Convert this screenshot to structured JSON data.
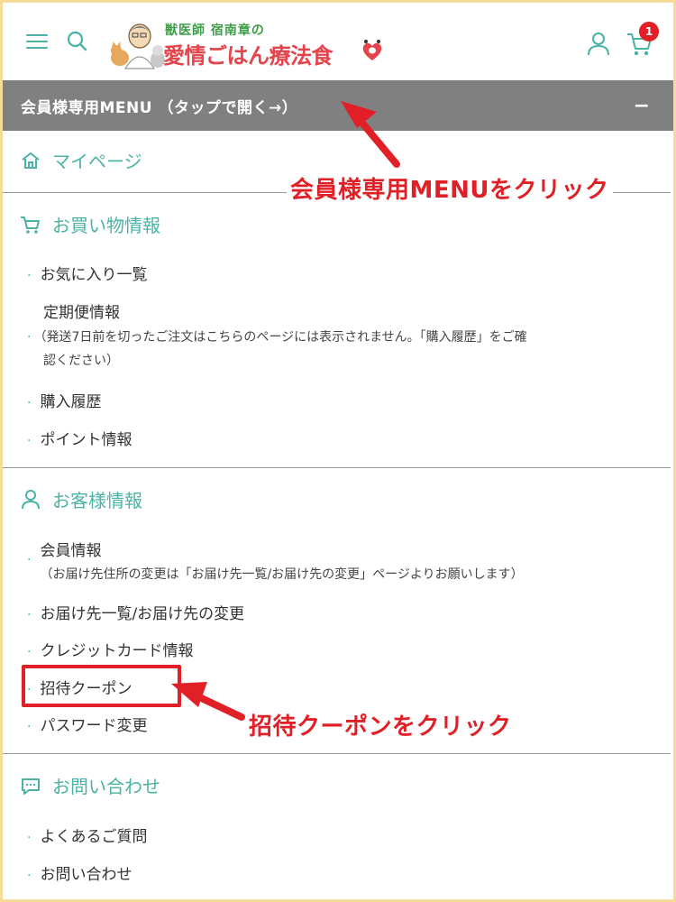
{
  "header": {
    "logo_sub": "獣医師 宿南章の",
    "logo_main": "愛情ごはん療法食",
    "cart_count": "1",
    "accent_color": "#4ab3a6"
  },
  "member_menu": {
    "label": "会員様専用MENU （タップで開く→）",
    "toggle": "−"
  },
  "mypage": {
    "label": "マイページ",
    "icon": "home-icon"
  },
  "shopping": {
    "title": "お買い物情報",
    "icon": "cart-icon",
    "items": [
      {
        "label": "お気に入り一覧"
      },
      {
        "label": "定期便情報",
        "note_1": "（発送7日前を切ったご注文はこちらのページには表示されません。「購入履歴」をご確",
        "note_2": "認ください）"
      },
      {
        "label": "購入履歴"
      },
      {
        "label": "ポイント情報"
      }
    ]
  },
  "customer": {
    "title": "お客様情報",
    "icon": "user-icon",
    "items": [
      {
        "label": "会員情報",
        "note": "（お届け先住所の変更は「お届け先一覧/お届け先の変更」ページよりお願いします）"
      },
      {
        "label": "お届け先一覧/お届け先の変更"
      },
      {
        "label": "クレジットカード情報"
      },
      {
        "label": "招待クーポン"
      },
      {
        "label": "パスワード変更"
      }
    ]
  },
  "contact": {
    "title": "お問い合わせ",
    "icon": "chat-icon",
    "items": [
      {
        "label": "よくあるご質問"
      },
      {
        "label": "お問い合わせ"
      }
    ]
  },
  "annotations": {
    "menu_click": "会員様専用MENUをクリック",
    "coupon_click": "招待クーポンをクリック",
    "color": "#e01f26"
  },
  "bullet": "·"
}
